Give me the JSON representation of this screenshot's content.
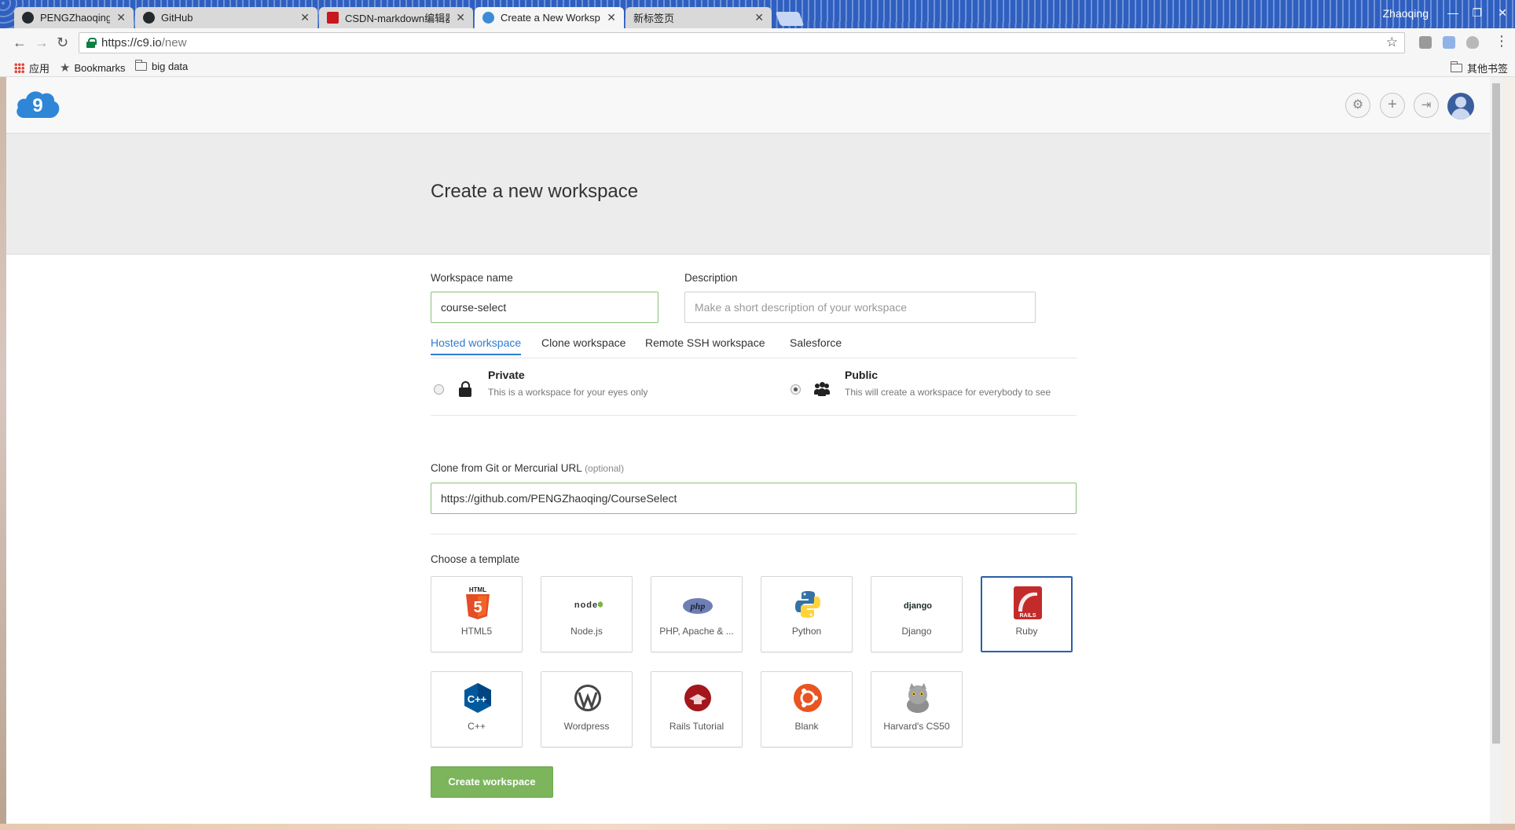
{
  "browser": {
    "tabs": [
      {
        "title": "PENGZhaoqing/CourseSelect",
        "active": false
      },
      {
        "title": "GitHub",
        "active": false
      },
      {
        "title": "CSDN-markdown编辑器",
        "active": false
      },
      {
        "title": "Create a New Workspace",
        "active": true
      },
      {
        "title": "新标签页",
        "active": false
      }
    ],
    "user": "Zhaoqing",
    "address": {
      "host": "https://c9.io",
      "path": "/new"
    },
    "bookmarks": {
      "apps": "应用",
      "bookmarks": "Bookmarks",
      "folder": "big data",
      "other": "其他书签"
    }
  },
  "page": {
    "title": "Create a new workspace",
    "workspace_name": {
      "label": "Workspace name",
      "value": "course-select"
    },
    "description": {
      "label": "Description",
      "placeholder": "Make a short description of your workspace"
    },
    "tabs": [
      "Hosted workspace",
      "Clone workspace",
      "Remote SSH workspace",
      "Salesforce"
    ],
    "privacy": {
      "private": {
        "title": "Private",
        "desc": "This is a workspace for your eyes only"
      },
      "public": {
        "title": "Public",
        "desc": "This will create a workspace for everybody to see"
      },
      "selected": "public"
    },
    "clone": {
      "label": "Clone from Git or Mercurial URL",
      "optional": "(optional)",
      "value": "https://github.com/PENGZhaoqing/CourseSelect"
    },
    "template_heading": "Choose a template",
    "templates": [
      {
        "name": "HTML5",
        "icon": "html5-icon"
      },
      {
        "name": "Node.js",
        "icon": "nodejs-icon"
      },
      {
        "name": "PHP, Apache & ...",
        "icon": "php-icon"
      },
      {
        "name": "Python",
        "icon": "python-icon"
      },
      {
        "name": "Django",
        "icon": "django-icon"
      },
      {
        "name": "Ruby",
        "icon": "rails-icon"
      },
      {
        "name": "C++",
        "icon": "cpp-icon"
      },
      {
        "name": "Wordpress",
        "icon": "wordpress-icon"
      },
      {
        "name": "Rails Tutorial",
        "icon": "rails-tutorial-icon"
      },
      {
        "name": "Blank",
        "icon": "ubuntu-icon"
      },
      {
        "name": "Harvard's CS50",
        "icon": "cs50-cat-icon"
      }
    ],
    "selected_template": "Ruby",
    "create_label": "Create workspace",
    "icon_text": {
      "html5_top": "HTML",
      "html5_num": "5",
      "node": "node",
      "php": "php",
      "django": "django",
      "rails": "RAILS",
      "cpp": "C++"
    }
  },
  "colors": {
    "accent_tab": "#2f7cd0",
    "create_button": "#7cb55c",
    "valid_border": "#8ac07a",
    "selected_template": "#2a5fa8"
  }
}
